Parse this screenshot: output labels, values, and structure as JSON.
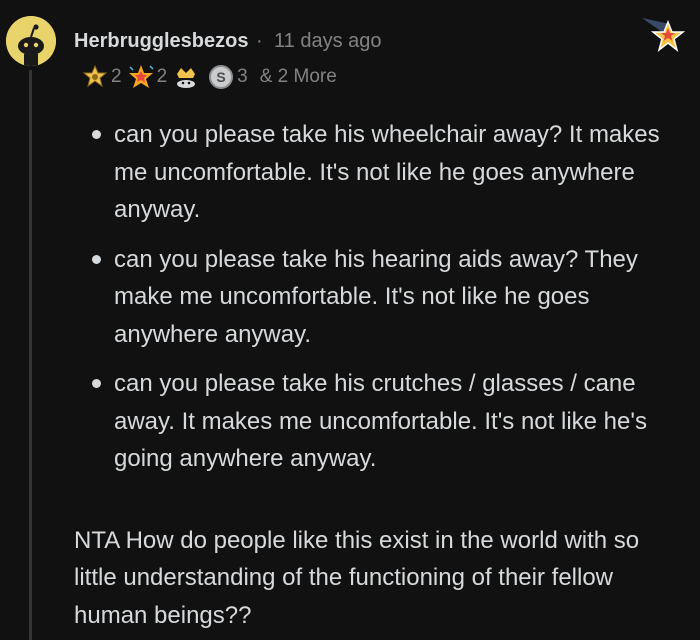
{
  "comment": {
    "username": "Herbrugglesbezos",
    "separator": "·",
    "time": "11 days ago",
    "awards": [
      {
        "icon": "helpful-award-icon",
        "count": "2"
      },
      {
        "icon": "wholesome-star-award-icon",
        "count": "2"
      },
      {
        "icon": "bravo-award-icon",
        "count": ""
      },
      {
        "icon": "silver-coin-award-icon",
        "count": "3"
      }
    ],
    "more_awards": "& 2 More",
    "bullets": [
      "can you please take his wheelchair away? It makes me uncomfortable. It's not like he goes anywhere anyway.",
      "can you please take his hearing aids away? They make me uncomfortable. It's not like he goes anywhere anyway.",
      "can you please take his crutches / glasses / cane away. It makes me uncomfortable. It's not like he's going anywhere anyway."
    ],
    "body": "NTA How do people like this exist in the world with so little understanding of the functioning of their fellow human beings??"
  },
  "colors": {
    "background": "#111111",
    "text": "#d7dadc",
    "meta": "#818384",
    "avatar": "#e9d46b",
    "thread_line": "#343536"
  }
}
